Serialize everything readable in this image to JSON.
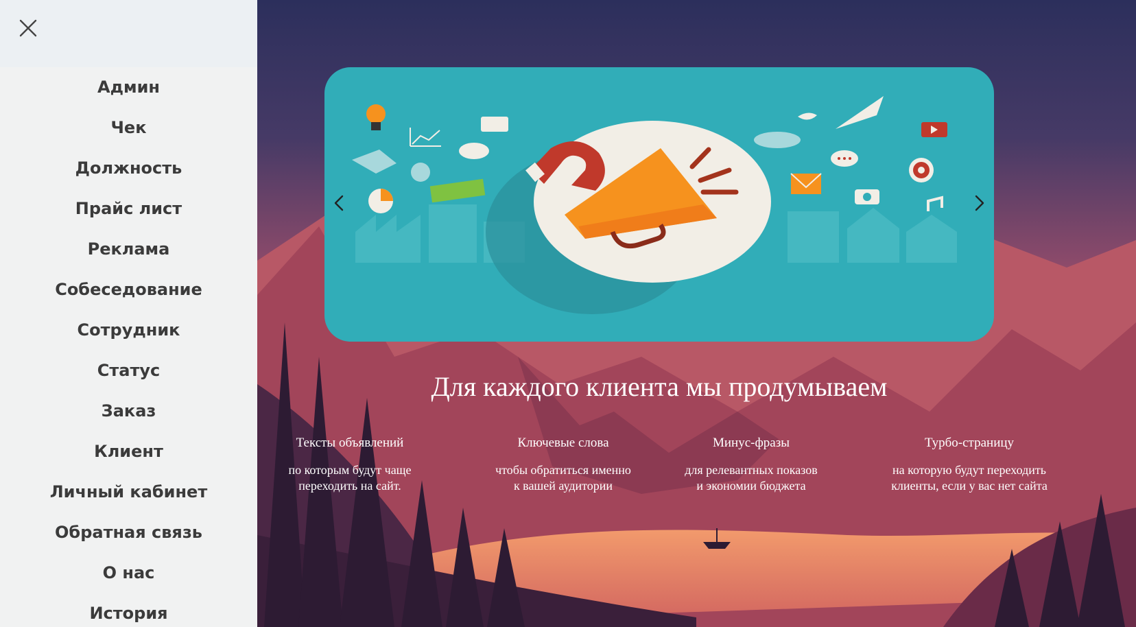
{
  "sidebar": {
    "close_icon": "close-icon",
    "items": [
      {
        "label": "Админ"
      },
      {
        "label": "Чек"
      },
      {
        "label": "Должность"
      },
      {
        "label": "Прайс лист"
      },
      {
        "label": "Реклама"
      },
      {
        "label": "Собеседование"
      },
      {
        "label": "Сотрудник"
      },
      {
        "label": "Статус"
      },
      {
        "label": "Заказ"
      },
      {
        "label": "Клиент"
      },
      {
        "label": "Личный кабинет"
      },
      {
        "label": "Обратная связь"
      },
      {
        "label": "О нас"
      },
      {
        "label": "История"
      }
    ]
  },
  "carousel": {
    "prev_icon": "chevron-left-icon",
    "next_icon": "chevron-right-icon",
    "background_color": "#31adb8"
  },
  "main": {
    "headline": "Для каждого клиента мы продумываем",
    "features": [
      {
        "title": "Тексты объявлений",
        "line1": "по которым будут чаще",
        "line2": "переходить на сайт."
      },
      {
        "title": "Ключевые слова",
        "line1": "чтобы обратиться именно",
        "line2": "к вашей аудитории"
      },
      {
        "title": "Минус-фразы",
        "line1": "для релевантных показов",
        "line2": "и экономии бюджета"
      },
      {
        "title": "Турбо-страницу",
        "line1": "на которую будут переходить",
        "line2": "клиенты, если у вас нет сайта"
      }
    ]
  }
}
